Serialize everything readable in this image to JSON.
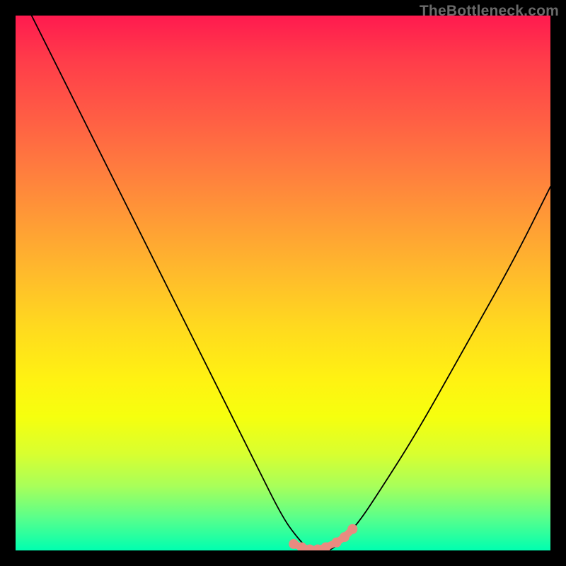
{
  "watermark": "TheBottleneck.com",
  "chart_data": {
    "type": "line",
    "title": "",
    "xlabel": "",
    "ylabel": "",
    "xlim": [
      0,
      100
    ],
    "ylim": [
      0,
      100
    ],
    "series": [
      {
        "name": "curve",
        "x": [
          3,
          8,
          15,
          22,
          30,
          38,
          45,
          50,
          53,
          55,
          57,
          59,
          61,
          64,
          68,
          75,
          84,
          93,
          100
        ],
        "y": [
          100,
          90,
          76,
          62,
          46,
          30,
          16,
          6,
          2,
          0,
          0,
          0,
          2,
          5,
          11,
          22,
          38,
          54,
          68
        ]
      }
    ],
    "markers": {
      "name": "highlight-dots",
      "color": "#e98a80",
      "points_x": [
        52,
        53.5,
        55,
        56.5,
        58,
        60,
        61.5,
        63
      ],
      "points_y": [
        1.2,
        0.6,
        0.2,
        0.2,
        0.6,
        1.5,
        2.5,
        4
      ]
    }
  }
}
